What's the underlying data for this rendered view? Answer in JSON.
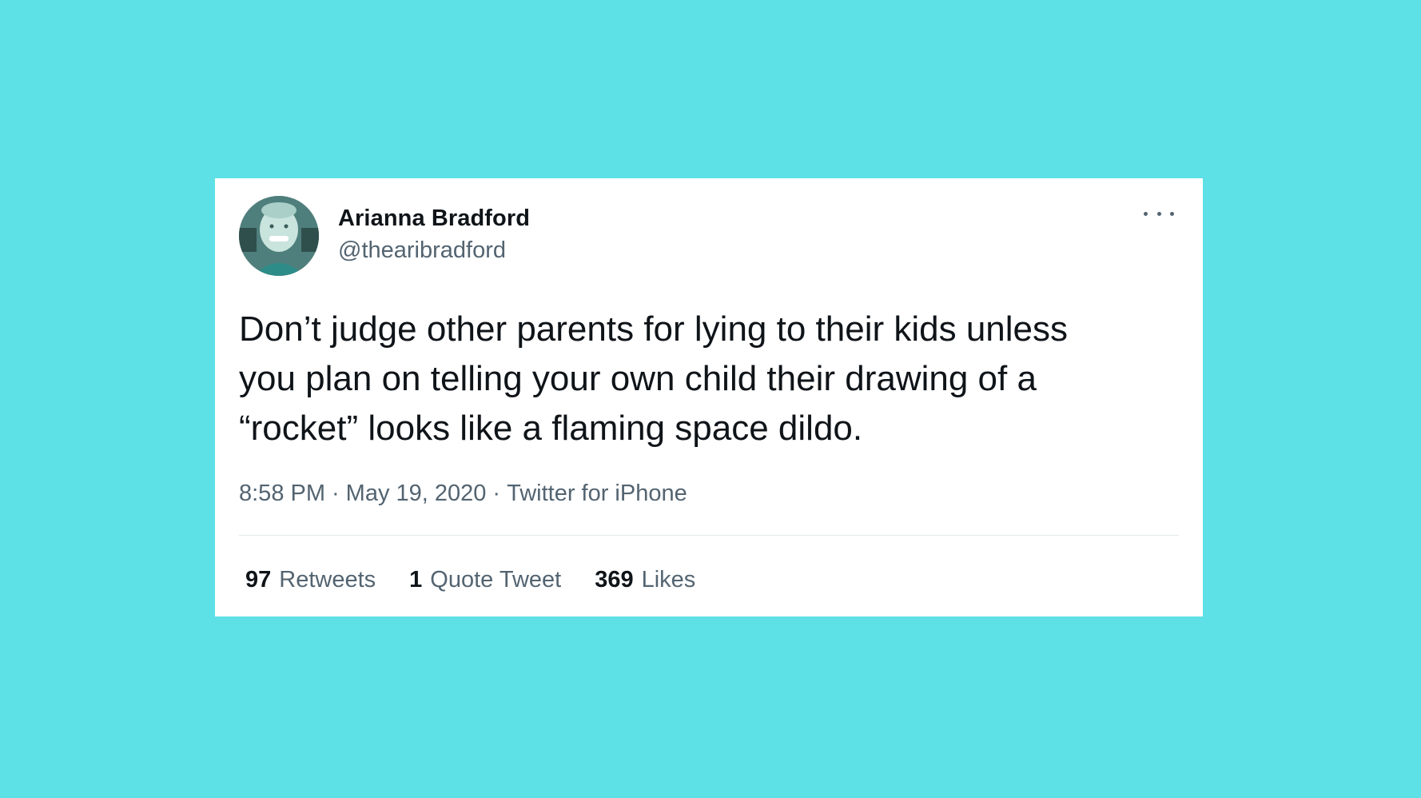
{
  "colors": {
    "background": "#5ee1e6",
    "card": "#ffffff",
    "primary_text": "#0f1419",
    "secondary_text": "#536471"
  },
  "author": {
    "name": "Arianna Bradford",
    "handle": "@thearibradford",
    "avatar_icon": "profile-photo"
  },
  "more_icon": "more-horizontal-icon",
  "tweet": {
    "text": "Don’t judge other parents for lying to their kids unless\nyou plan on telling your own child their drawing of a\n“rocket” looks like a flaming space dildo.",
    "time": "8:58 PM",
    "separator": "·",
    "date": "May 19, 2020",
    "source": "Twitter for iPhone"
  },
  "stats": [
    {
      "count": "97",
      "label": "Retweets"
    },
    {
      "count": "1",
      "label": "Quote Tweet"
    },
    {
      "count": "369",
      "label": "Likes"
    }
  ]
}
